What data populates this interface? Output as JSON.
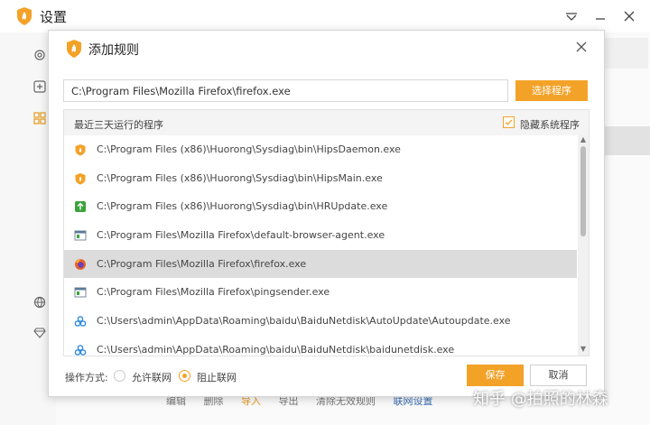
{
  "main": {
    "title": "设置",
    "bottom_actions": [
      "编辑",
      "删除",
      "导入",
      "导出",
      "清除无效规则",
      "联网设置"
    ]
  },
  "dialog": {
    "title": "添加规则",
    "path_value": "C:\\Program Files\\Mozilla Firefox\\firefox.exe",
    "select_program_label": "选择程序",
    "recent_label": "最近三天运行的程序",
    "hide_system_label": "隐藏系统程序",
    "hide_system_checked": true,
    "programs": [
      {
        "path": "C:\\Program Files (x86)\\Huorong\\Sysdiag\\bin\\HipsDaemon.exe",
        "icon": "huorong-shield-icon"
      },
      {
        "path": "C:\\Program Files (x86)\\Huorong\\Sysdiag\\bin\\HipsMain.exe",
        "icon": "huorong-shield-icon"
      },
      {
        "path": "C:\\Program Files (x86)\\Huorong\\Sysdiag\\bin\\HRUpdate.exe",
        "icon": "update-icon"
      },
      {
        "path": "C:\\Program Files\\Mozilla Firefox\\default-browser-agent.exe",
        "icon": "window-app-icon"
      },
      {
        "path": "C:\\Program Files\\Mozilla Firefox\\firefox.exe",
        "icon": "firefox-icon"
      },
      {
        "path": "C:\\Program Files\\Mozilla Firefox\\pingsender.exe",
        "icon": "window-app-icon"
      },
      {
        "path": "C:\\Users\\admin\\AppData\\Roaming\\baidu\\BaiduNetdisk\\AutoUpdate\\Autoupdate.exe",
        "icon": "baidu-netdisk-icon"
      },
      {
        "path": "C:\\Users\\admin\\AppData\\Roaming\\baidu\\BaiduNetdisk\\baidunetdisk.exe",
        "icon": "baidu-netdisk-icon"
      }
    ],
    "selected_index": 4,
    "operation_label": "操作方式:",
    "allow_label": "允许联网",
    "block_label": "阻止联网",
    "selected_operation": "block",
    "save_label": "保存",
    "cancel_label": "取消"
  },
  "watermark": "知乎 @拍照的林森",
  "colors": {
    "accent": "#f3a228",
    "selected_row": "#dcdcdc"
  }
}
